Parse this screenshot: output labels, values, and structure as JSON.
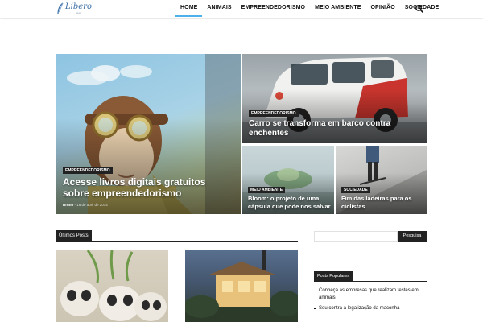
{
  "header": {
    "logo": {
      "name": "Libero",
      "tagline": "news"
    },
    "nav": [
      {
        "label": "HOME",
        "active": true
      },
      {
        "label": "ANIMAIS"
      },
      {
        "label": "EMPREENDEDORISMO"
      },
      {
        "label": "MEIO AMBIENTE"
      },
      {
        "label": "OPINIÃO"
      },
      {
        "label": "SOCIEDADE"
      }
    ],
    "search_icon": "search-icon"
  },
  "featured": {
    "main": {
      "category": "EMPREENDEDORISMO",
      "title_line1": "Acesse livros digitais gratuitos",
      "title_line2": "sobre empreendedorismo",
      "author": "Bruno",
      "date": "16 de abril de 2014"
    },
    "car": {
      "category": "EMPREENDEDORISMO",
      "title_line1": "Carro se transforma em barco contra",
      "title_line2": "enchentes"
    },
    "bloom": {
      "category": "MEIO AMBIENTE",
      "title_line1": "Bloom: o projeto de uma",
      "title_line2": "cápsula que pode nos salvar"
    },
    "ladeiras": {
      "category": "SOCIEDADE",
      "title_line1": "Fim das ladeiras para os",
      "title_line2": "ciclistas"
    }
  },
  "latest": {
    "heading": "Últimos Posts"
  },
  "sidebar": {
    "search_placeholder": "",
    "search_button": "Pesquisa",
    "popular_heading": "Posts Populares",
    "popular": [
      {
        "line1": "Conheça as empresas que realizam testes em",
        "line2": "animais"
      },
      {
        "line1": "Sou contra a legalização da maconha",
        "line2": ""
      }
    ]
  },
  "colors": {
    "accent": "#4db2ec",
    "dark": "#222222"
  }
}
